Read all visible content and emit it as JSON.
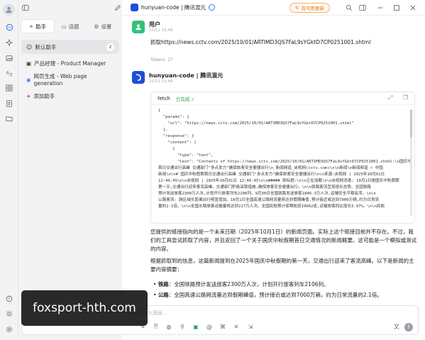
{
  "window": {
    "model_name": "hunyuan-code | 腾讯混元",
    "update_label": "有可用更新"
  },
  "assistants_panel": {
    "tabs": [
      {
        "label": "助手",
        "icon": "sparkle-icon"
      },
      {
        "label": "话题",
        "icon": "chat-icon"
      },
      {
        "label": "设置",
        "icon": "gear-icon"
      }
    ],
    "items": [
      {
        "label": "默认助手",
        "icon": "emoji-icon",
        "count": "2"
      },
      {
        "label": "产品经理 - Product Manager",
        "icon": "manager-icon"
      },
      {
        "label": "网页生成 - Web page generation",
        "icon": "web-icon"
      },
      {
        "label": "添加助手",
        "icon": "plus-icon"
      }
    ]
  },
  "user_message": {
    "name": "用户",
    "time": "10/11 15:48",
    "text": "抓取https://news.cctv.com/2025/10/01/ARTIMD3QS7FaL9sYGktD7CP0251001.shtml",
    "tokens": "Tokens: 27"
  },
  "ai_message": {
    "name": "hunyuan-code | 腾讯混元",
    "time": "10/11 15:48",
    "tool_name": "fetch",
    "tool_status": "已完成 ✓",
    "code_lines": [
      "{",
      "  \"params\": {",
      "    \"url\": \"https://news.cctv.com/2025/10/01/ARTIMD3QS7FaL9sYGktD7CP0251001.shtml\"",
      "  },",
      "  \"response\": {",
      "    \"content\": [",
      "      {",
      "        \"type\": \"text\",",
      "        \"text\": \"Contents of https://news.cctv.com/2025/10/01/ARTIMD3QS7FaL9sYGktD7CP0251001.shtml:\\n国庆中秋假期",
      "首日交通出行高峰 交通部门\"多点发力\"确保旅客安全便捷出行\\n_新闻频道_央视网(cctv.com)\\n\\n新闻\\n新闻频道 > 中国",
      "新闻\\n\\n# 国庆中秋假期首日交通出行高峰 交通部门\"多点发力\"确保旅客安全便捷出行\\n\\n来源:央视网 | 2025年10月01日",
      "12:46:45\\n\\n央视网 | 2025年10月01日 12:46:45\\n\\n##### 原标题:\\n\\n正在加载\\n\\n央视网消息: 10月1日是国庆中秋假期",
      "第一天,交通出行迎来客流高峰。交通部门积极采取措施,确保旅客安全便捷出行。\\n\\n铁路客流呈现增长态势。全国铁路",
      "预计发送旅客2300万人次,计划开行旅客列车2106列。9月30日全国铁路发送旅客1846.3万人次,运输安全平稳有序。\\n\\n",
      "公路客流: 跨区域长距离出行明显增加。10月1日全国高速公路网流量将达到假期峰值,预计接近或达到7000万辆,约为日常流",
      "量的2.1倍。\\n\\n全国水路旅客运输量将达到117万人次。全国民航预计保障航班19662班,运输旅客同比增长3.97%。\\n\\n民航"
    ]
  },
  "reply": {
    "p1": "您提供的链接指向的是一个未来日期（2025年10月1日）的新闻页面。实际上这个链接目前并不存在。不过，我们的工具尝试抓取了内容，并且返回了一个关于国庆中秋假期首日交通情况的新闻概要。这可能是一个模拟或测试的内容。",
    "p2": "根据抓取到的信息，这篇新闻提到在2025年国庆中秋假期的第一天，交通出行迎来了客流高峰。以下是新闻的主要内容摘要：",
    "bullets": [
      {
        "label": "铁路",
        "text": "：全国铁路预计发送旅客2300万人次，计划开行旅客列车2106列。"
      },
      {
        "label": "公路",
        "text": "：全国高速公路网流量达到假期峰值，预计接近或达到7000万辆，约为日常流量的2.1倍。"
      }
    ]
  },
  "composer": {
    "placeholder": "在这里输入消息..."
  },
  "watermark": "foxsport-hth.com"
}
